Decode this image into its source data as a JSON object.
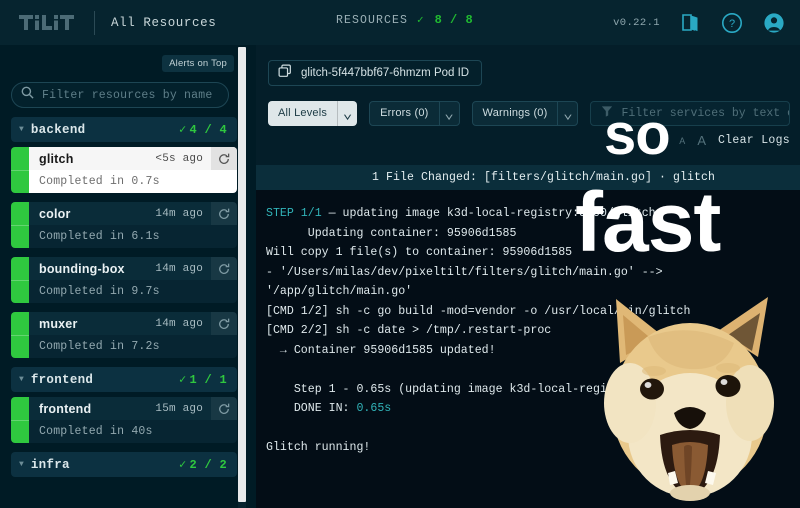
{
  "header": {
    "logo_text": "TILT",
    "nav_title": "All Resources",
    "resources_label": "RESOURCES",
    "resources_count": "8 / 8",
    "check": "✓",
    "version": "v0.22.1",
    "icons": [
      "book-icon",
      "help-icon",
      "account-icon"
    ]
  },
  "sidebar": {
    "alerts_chip": "Alerts on Top",
    "filter": {
      "placeholder": "Filter resources by name",
      "value": "",
      "icon": "search-icon"
    },
    "groups": [
      {
        "name": "backend",
        "count": "4 / 4",
        "check": "✓",
        "triangle": "▼",
        "items": [
          {
            "name": "glitch",
            "time": "<5s ago",
            "status": "Completed in 0.7s",
            "selected": true
          },
          {
            "name": "color",
            "time": "14m ago",
            "status": "Completed in 6.1s",
            "selected": false
          },
          {
            "name": "bounding-box",
            "time": "14m ago",
            "status": "Completed in 9.7s",
            "selected": false
          },
          {
            "name": "muxer",
            "time": "14m ago",
            "status": "Completed in 7.2s",
            "selected": false
          }
        ]
      },
      {
        "name": "frontend",
        "count": "1 / 1",
        "check": "✓",
        "triangle": "▼",
        "items": [
          {
            "name": "frontend",
            "time": "15m ago",
            "status": "Completed in 40s",
            "selected": false
          }
        ]
      },
      {
        "name": "infra",
        "count": "2 / 2",
        "check": "✓",
        "triangle": "▼",
        "items": []
      }
    ]
  },
  "main": {
    "pod": {
      "label": "glitch-5f447bbf67-6hmzm Pod ID",
      "icon": "copy-icon"
    },
    "toolbar": {
      "levels": {
        "label": "All Levels",
        "caret": "⌄"
      },
      "errors": {
        "label": "Errors (0)",
        "caret": "⌄"
      },
      "warnings": {
        "label": "Warnings (0)",
        "caret": "⌄"
      },
      "log_filter": {
        "placeholder": "Filter services by text or /regexp/",
        "value": "",
        "icon": "funnel-icon"
      },
      "font_small": "A",
      "font_large": "A",
      "clear_logs": "Clear Logs"
    },
    "file_banner": "1 File Changed: [filters/glitch/main.go] · glitch",
    "log_lines": [
      {
        "prefix": "STEP 1/1",
        "text": " — updating image k3d-local-registry:5000/glitch"
      },
      {
        "text": "      Updating container: 95906d1585"
      },
      {
        "text": "Will copy 1 file(s) to container: 95906d1585"
      },
      {
        "text": "- '/Users/milas/dev/pixeltilt/filters/glitch/main.go' -->"
      },
      {
        "text": "'/app/glitch/main.go'"
      },
      {
        "text": "[CMD 1/2] sh -c go build -mod=vendor -o /usr/local/bin/glitch"
      },
      {
        "text": "[CMD 2/2] sh -c date > /tmp/.restart-proc"
      },
      {
        "text": "  → Container 95906d1585 updated!"
      },
      {
        "text": ""
      },
      {
        "text": "    Step 1 - 0.65s (updating image k3d-local-registry:5000/gl"
      },
      {
        "prefix2": "    DONE IN: ",
        "teal": "0.65s"
      },
      {
        "text": ""
      },
      {
        "text": "Glitch running!"
      }
    ]
  },
  "overlay": {
    "word_one": "so",
    "word_two": "fast",
    "mascot": "doge-shiba-inu-image"
  },
  "colors": {
    "header_bg": "#06242f",
    "sidebar_bg": "#001b25",
    "main_bg": "#041e29",
    "log_bg": "#030d16",
    "accent_green": "#2fc83f",
    "accent_teal": "#31b3b8",
    "banner_bg": "#0b2e3b"
  }
}
